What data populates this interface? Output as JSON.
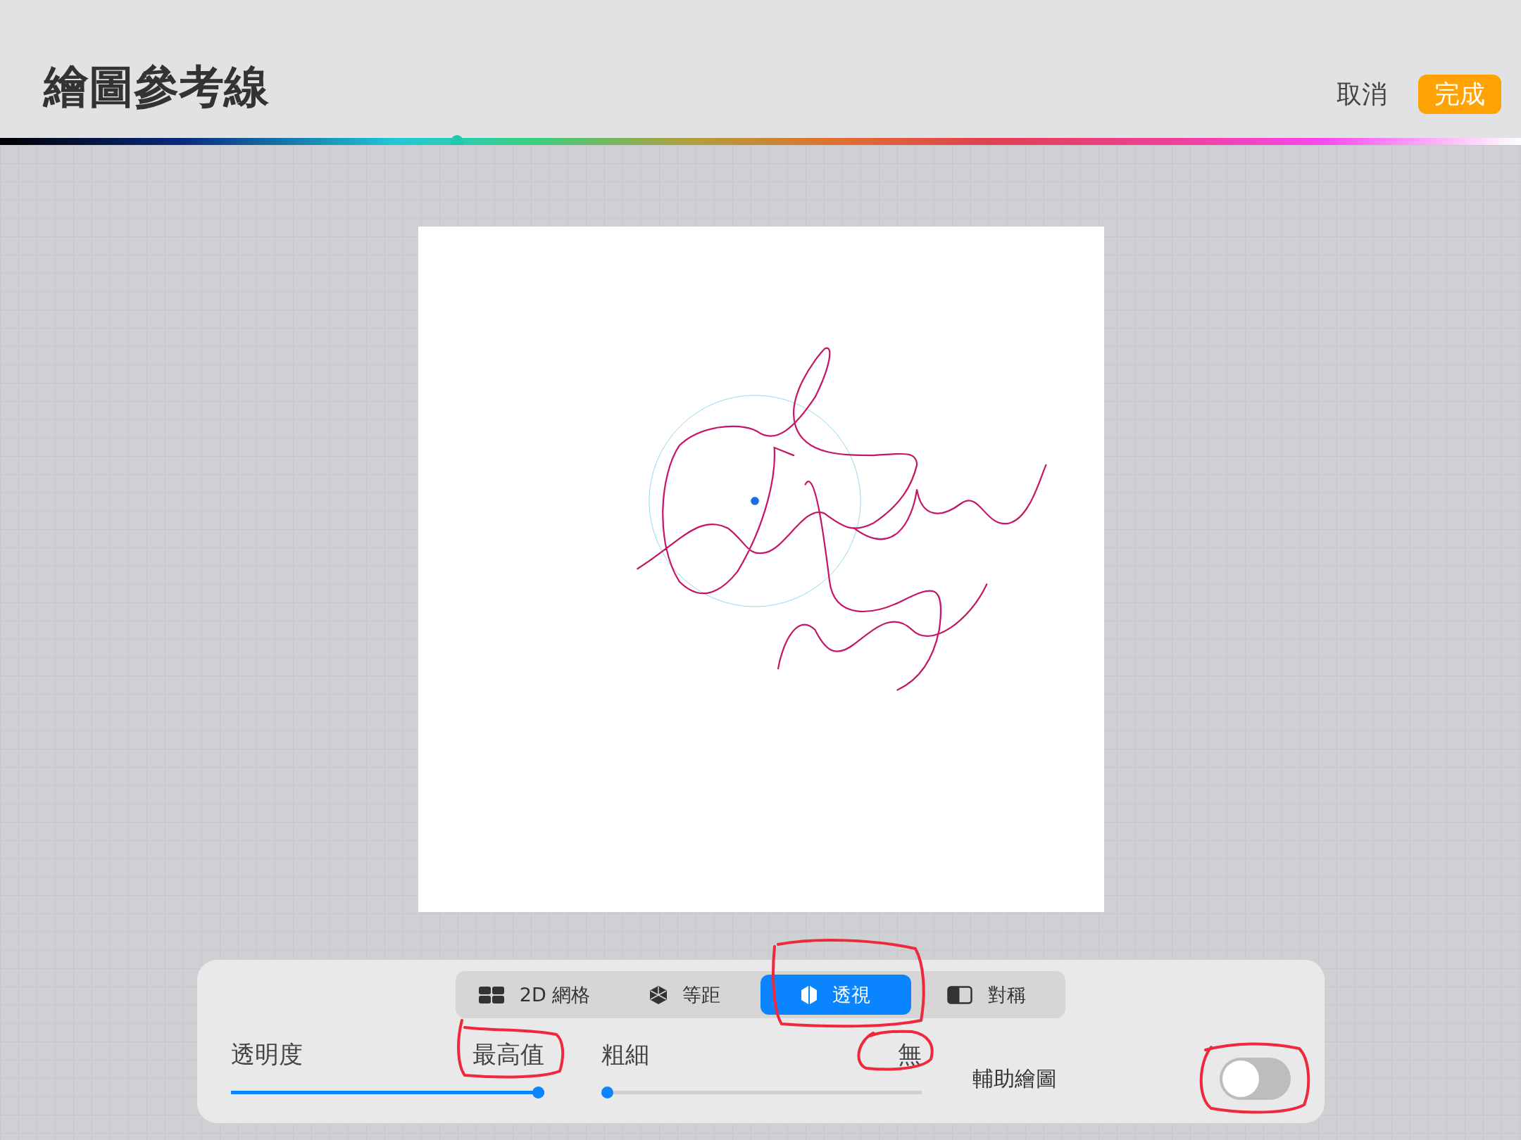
{
  "header": {
    "title": "繪圖參考線",
    "cancel": "取消",
    "done": "完成"
  },
  "guide_color": {
    "level": 0.3
  },
  "guide_types": [
    {
      "label": "2D 網格",
      "kind": "grid",
      "selected": false
    },
    {
      "label": "等距",
      "kind": "isometric",
      "selected": false
    },
    {
      "label": "透視",
      "kind": "perspective",
      "selected": true
    },
    {
      "label": "對稱",
      "kind": "symmetry",
      "selected": false
    }
  ],
  "sliders": [
    {
      "label": "透明度",
      "reading": "最高值",
      "level": 1
    },
    {
      "label": "粗細",
      "reading": "無",
      "level": 0
    }
  ],
  "assisted_drawing": {
    "label": "輔助繪圖",
    "on": false
  }
}
